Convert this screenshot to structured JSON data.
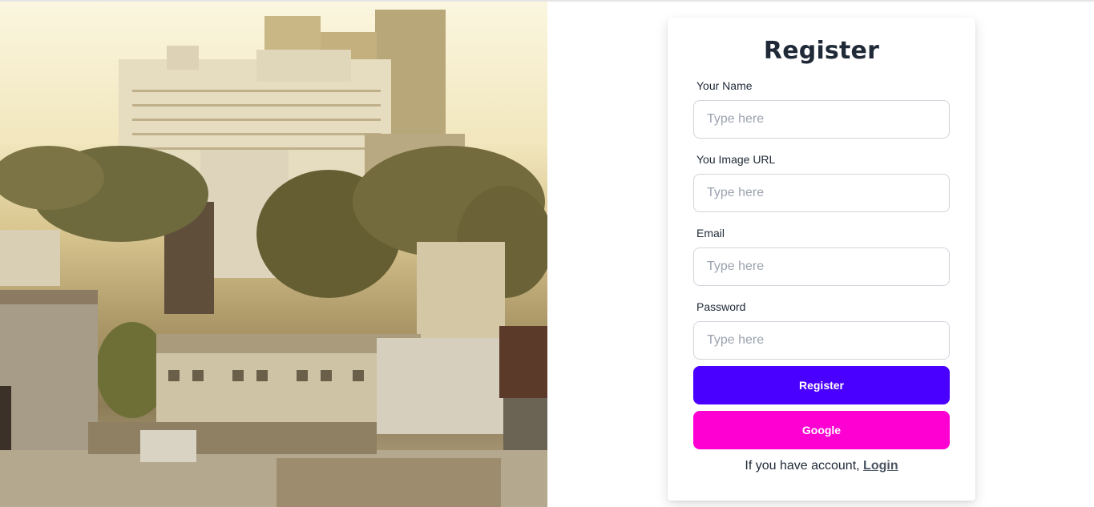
{
  "hero": {
    "image_description_icon": "city-photo"
  },
  "form": {
    "title": "Register",
    "fields": [
      {
        "label": "Your Name",
        "placeholder": "Type here",
        "value": ""
      },
      {
        "label": "You Image URL",
        "placeholder": "Type here",
        "value": ""
      },
      {
        "label": "Email",
        "placeholder": "Type here",
        "value": ""
      },
      {
        "label": "Password",
        "placeholder": "Type here",
        "value": ""
      }
    ],
    "register_label": "Register",
    "google_label": "Google",
    "footer_text": "If you have account, ",
    "login_label": "Login"
  },
  "colors": {
    "primary": "#4a00ff",
    "secondary": "#ff00d3",
    "text": "#1f2937",
    "placeholder": "#9ca3af"
  }
}
